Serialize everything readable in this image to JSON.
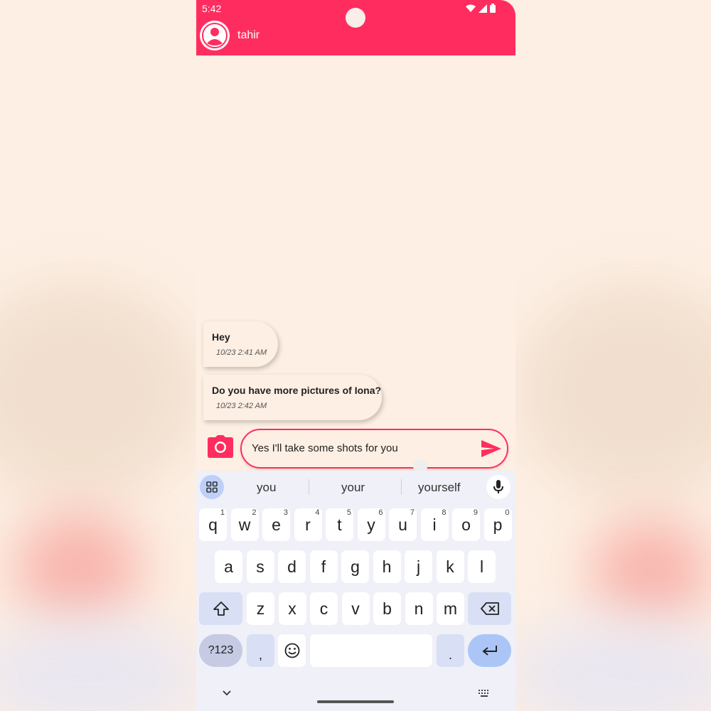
{
  "status_bar": {
    "time": "5:42"
  },
  "header": {
    "contact_name": "tahir"
  },
  "messages": [
    {
      "text": "Hey",
      "time": "10/23 2:41 AM"
    },
    {
      "text": "Do you have more pictures of Iona?",
      "time": "10/23 2:42 AM"
    }
  ],
  "composer": {
    "value": "Yes I'll take some shots for you"
  },
  "keyboard": {
    "suggestions": [
      "you",
      "your",
      "yourself"
    ],
    "row1": [
      {
        "key": "q",
        "hint": "1"
      },
      {
        "key": "w",
        "hint": "2"
      },
      {
        "key": "e",
        "hint": "3"
      },
      {
        "key": "r",
        "hint": "4"
      },
      {
        "key": "t",
        "hint": "5"
      },
      {
        "key": "y",
        "hint": "6"
      },
      {
        "key": "u",
        "hint": "7"
      },
      {
        "key": "i",
        "hint": "8"
      },
      {
        "key": "o",
        "hint": "9"
      },
      {
        "key": "p",
        "hint": "0"
      }
    ],
    "row2": [
      "a",
      "s",
      "d",
      "f",
      "g",
      "h",
      "j",
      "k",
      "l"
    ],
    "row3": [
      "z",
      "x",
      "c",
      "v",
      "b",
      "n",
      "m"
    ],
    "symbols_label": "?123",
    "comma": ",",
    "period": "."
  },
  "colors": {
    "accent": "#ff2d5f",
    "background": "#fdefe3",
    "keyboard_bg": "#eff0f8"
  },
  "icons": [
    "profile-icon",
    "camera-icon",
    "send-icon",
    "apps-grid-icon",
    "mic-icon",
    "shift-icon",
    "backspace-icon",
    "emoji-icon",
    "enter-icon",
    "chevron-down-icon",
    "keyboard-icon",
    "wifi-icon",
    "signal-icon",
    "battery-icon"
  ]
}
